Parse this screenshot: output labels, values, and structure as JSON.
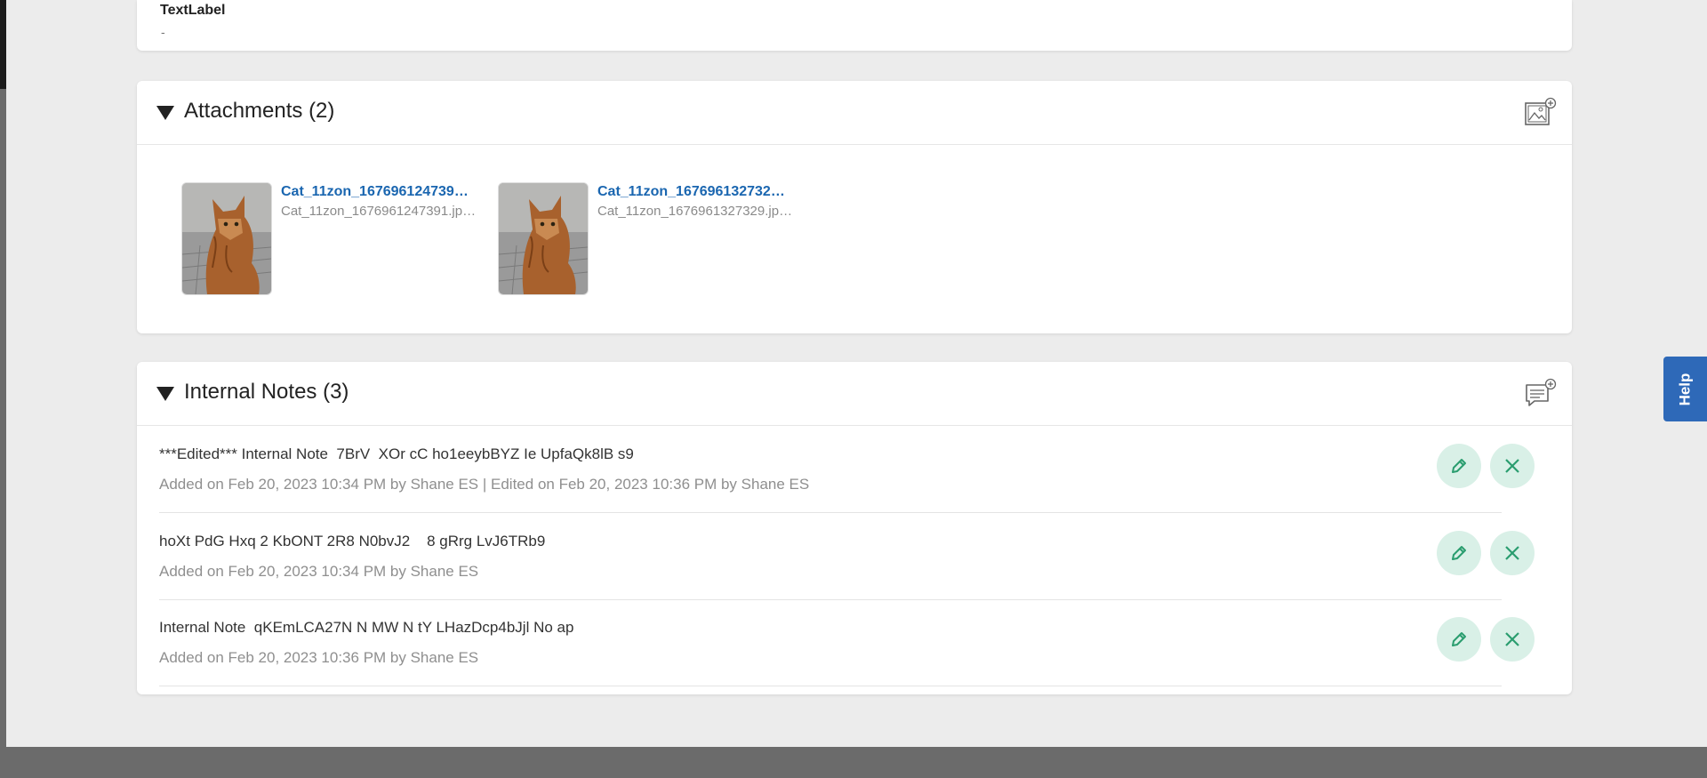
{
  "top_field": {
    "label": "TextLabel",
    "value": "-"
  },
  "attachments": {
    "title": "Attachments (2)",
    "add_icon": "image-add-icon",
    "items": [
      {
        "name": "Cat_11zon_167696124739…",
        "file": "Cat_11zon_1676961247391.jp…"
      },
      {
        "name": "Cat_11zon_167696132732…",
        "file": "Cat_11zon_1676961327329.jp…"
      }
    ]
  },
  "notes": {
    "title": "Internal Notes (3)",
    "add_icon": "note-add-icon",
    "items": [
      {
        "text": "***Edited*** Internal Note  7BrV  XOr cC ho1eeybBYZ Ie UpfaQk8lB s9",
        "meta": "Added on Feb 20, 2023 10:34 PM by Shane ES | Edited on Feb 20, 2023 10:36 PM by Shane ES"
      },
      {
        "text": "hoXt PdG Hxq 2 KbONT 2R8 N0bvJ2    8 gRrg LvJ6TRb9",
        "meta": "Added on Feb 20, 2023 10:34 PM by Shane ES"
      },
      {
        "text": "Internal Note  qKEmLCA27N N MW N tY LHazDcp4bJjl No ap",
        "meta": "Added on Feb 20, 2023 10:36 PM by Shane ES"
      }
    ]
  },
  "help": {
    "label": "Help"
  },
  "colors": {
    "link": "#1a66b0",
    "action_bg": "#d9f0e7",
    "action_icon": "#2a9d6f",
    "help_bg": "#2e69b8"
  }
}
